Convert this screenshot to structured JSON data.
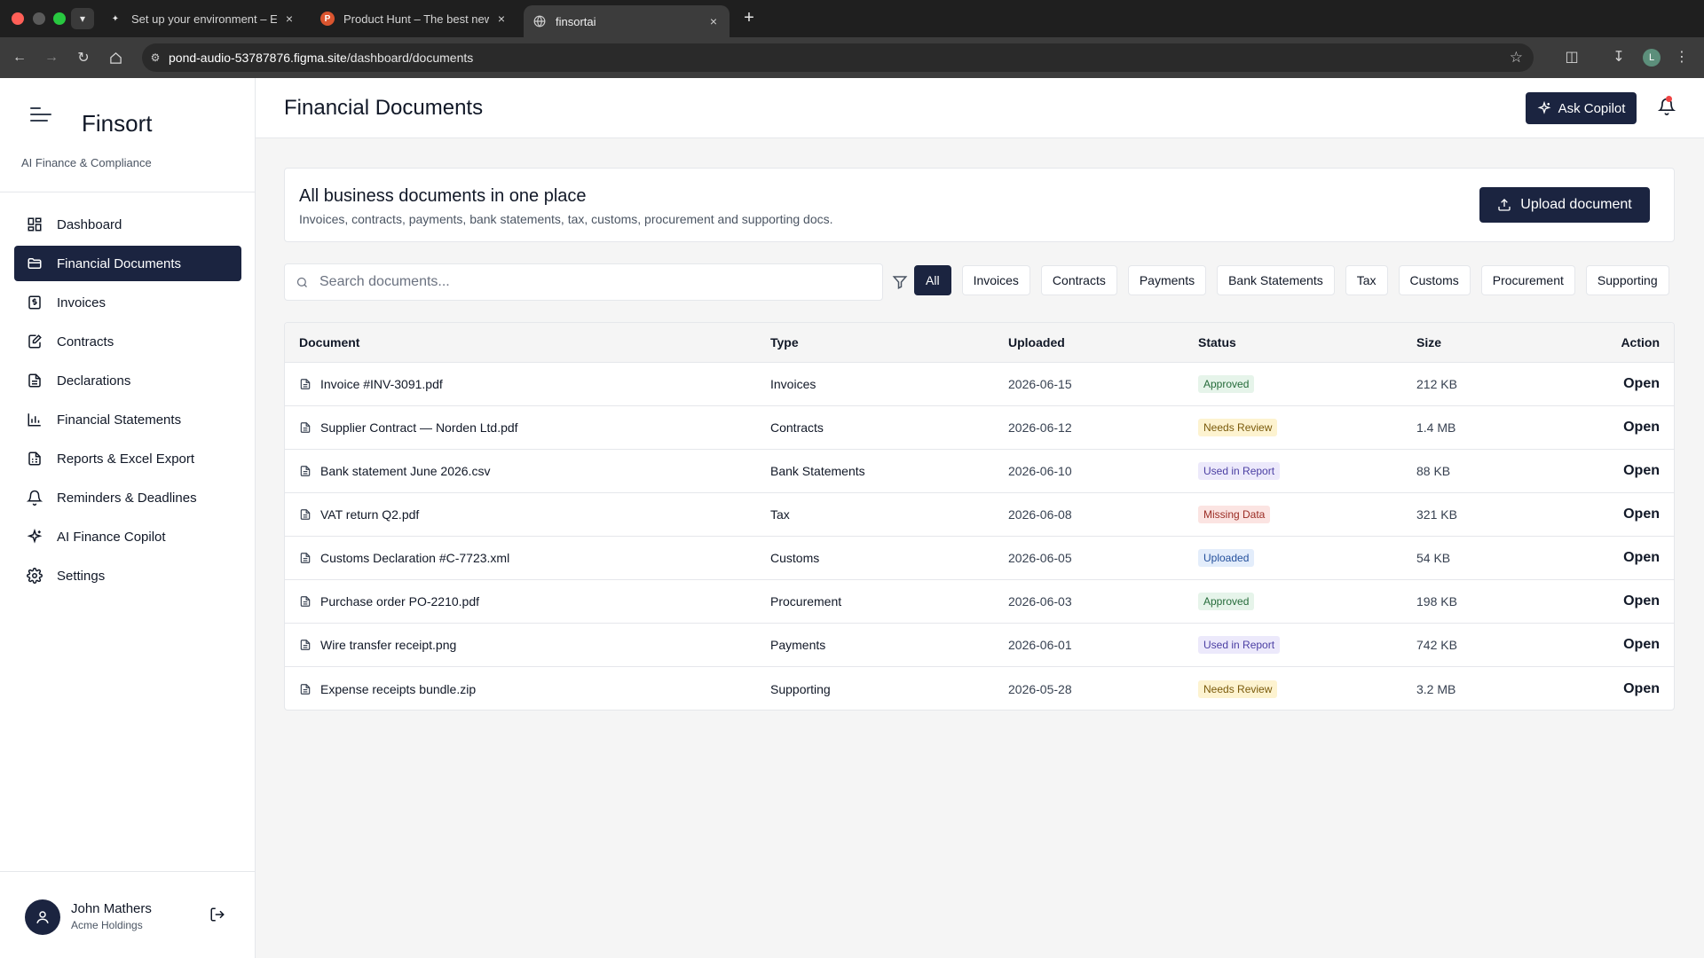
{
  "browser": {
    "tabs": [
      {
        "title": "Set up your environment – Ex",
        "active": false
      },
      {
        "title": "Product Hunt – The best new",
        "active": false
      },
      {
        "title": "finsortai",
        "active": true
      }
    ],
    "tab2_favicon_letter": "P",
    "url_host": "pond-audio-53787876.figma.site",
    "url_path": "/dashboard/documents",
    "profile_letter": "L"
  },
  "sidebar": {
    "brand": "Finsort",
    "subtitle": "AI Finance & Compliance",
    "items": [
      {
        "label": "Dashboard",
        "icon": "dashboard-icon",
        "active": false
      },
      {
        "label": "Financial Documents",
        "icon": "folder-icon",
        "active": true
      },
      {
        "label": "Invoices",
        "icon": "invoice-icon",
        "active": false
      },
      {
        "label": "Contracts",
        "icon": "contract-icon",
        "active": false
      },
      {
        "label": "Declarations",
        "icon": "declaration-icon",
        "active": false
      },
      {
        "label": "Financial Statements",
        "icon": "chart-icon",
        "active": false
      },
      {
        "label": "Reports & Excel Export",
        "icon": "report-icon",
        "active": false
      },
      {
        "label": "Reminders & Deadlines",
        "icon": "bell-icon",
        "active": false
      },
      {
        "label": "AI Finance Copilot",
        "icon": "sparkle-icon",
        "active": false
      },
      {
        "label": "Settings",
        "icon": "gear-icon",
        "active": false
      }
    ],
    "user": {
      "name": "John Mathers",
      "org": "Acme Holdings"
    }
  },
  "header": {
    "title": "Financial Documents",
    "copilot_label": "Ask Copilot"
  },
  "hero": {
    "title": "All business documents in one place",
    "subtitle": "Invoices, contracts, payments, bank statements, tax, customs, procurement and supporting docs.",
    "upload_label": "Upload document"
  },
  "search": {
    "placeholder": "Search documents...",
    "value": ""
  },
  "filters": [
    {
      "label": "All",
      "active": true
    },
    {
      "label": "Invoices",
      "active": false
    },
    {
      "label": "Contracts",
      "active": false
    },
    {
      "label": "Payments",
      "active": false
    },
    {
      "label": "Bank Statements",
      "active": false
    },
    {
      "label": "Tax",
      "active": false
    },
    {
      "label": "Customs",
      "active": false
    },
    {
      "label": "Procurement",
      "active": false
    },
    {
      "label": "Supporting",
      "active": false
    }
  ],
  "table": {
    "columns": [
      "Document",
      "Type",
      "Uploaded",
      "Status",
      "Size",
      "Action"
    ],
    "rows": [
      {
        "document": "Invoice #INV-3091.pdf",
        "type": "Invoices",
        "uploaded": "2026-06-15",
        "status": "Approved",
        "size": "212 KB",
        "action": "Open"
      },
      {
        "document": "Supplier Contract — Norden Ltd.pdf",
        "type": "Contracts",
        "uploaded": "2026-06-12",
        "status": "Needs Review",
        "size": "1.4 MB",
        "action": "Open"
      },
      {
        "document": "Bank statement June 2026.csv",
        "type": "Bank Statements",
        "uploaded": "2026-06-10",
        "status": "Used in Report",
        "size": "88 KB",
        "action": "Open"
      },
      {
        "document": "VAT return Q2.pdf",
        "type": "Tax",
        "uploaded": "2026-06-08",
        "status": "Missing Data",
        "size": "321 KB",
        "action": "Open"
      },
      {
        "document": "Customs Declaration #C-7723.xml",
        "type": "Customs",
        "uploaded": "2026-06-05",
        "status": "Uploaded",
        "size": "54 KB",
        "action": "Open"
      },
      {
        "document": "Purchase order PO-2210.pdf",
        "type": "Procurement",
        "uploaded": "2026-06-03",
        "status": "Approved",
        "size": "198 KB",
        "action": "Open"
      },
      {
        "document": "Wire transfer receipt.png",
        "type": "Payments",
        "uploaded": "2026-06-01",
        "status": "Used in Report",
        "size": "742 KB",
        "action": "Open"
      },
      {
        "document": "Expense receipts bundle.zip",
        "type": "Supporting",
        "uploaded": "2026-05-28",
        "status": "Needs Review",
        "size": "3.2 MB",
        "action": "Open"
      }
    ]
  },
  "status_colors": {
    "Approved": {
      "bg": "#e6f4ea",
      "fg": "#256b3a"
    },
    "Needs Review": {
      "bg": "#fdf3d0",
      "fg": "#7a5a0b"
    },
    "Used in Report": {
      "bg": "#ece9fb",
      "fg": "#4b3fa3"
    },
    "Missing Data": {
      "bg": "#fbe4e2",
      "fg": "#9b2c24"
    },
    "Uploaded": {
      "bg": "#e3edfb",
      "fg": "#24509c"
    }
  },
  "colors": {
    "accent": "#1b2440",
    "notification": "#ef4444"
  }
}
